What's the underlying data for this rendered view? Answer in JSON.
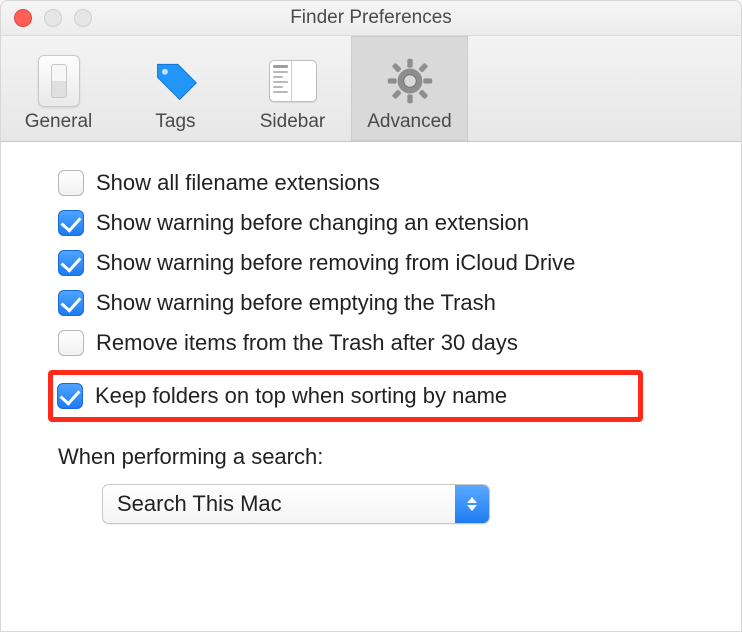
{
  "window": {
    "title": "Finder Preferences"
  },
  "toolbar": {
    "items": [
      {
        "label": "General"
      },
      {
        "label": "Tags"
      },
      {
        "label": "Sidebar"
      },
      {
        "label": "Advanced"
      }
    ]
  },
  "options": [
    {
      "label": "Show all filename extensions",
      "checked": false
    },
    {
      "label": "Show warning before changing an extension",
      "checked": true
    },
    {
      "label": "Show warning before removing from iCloud Drive",
      "checked": true
    },
    {
      "label": "Show warning before emptying the Trash",
      "checked": true
    },
    {
      "label": "Remove items from the Trash after 30 days",
      "checked": false
    },
    {
      "label": "Keep folders on top when sorting by name",
      "checked": true
    }
  ],
  "search": {
    "section_label": "When performing a search:",
    "selected": "Search This Mac"
  }
}
